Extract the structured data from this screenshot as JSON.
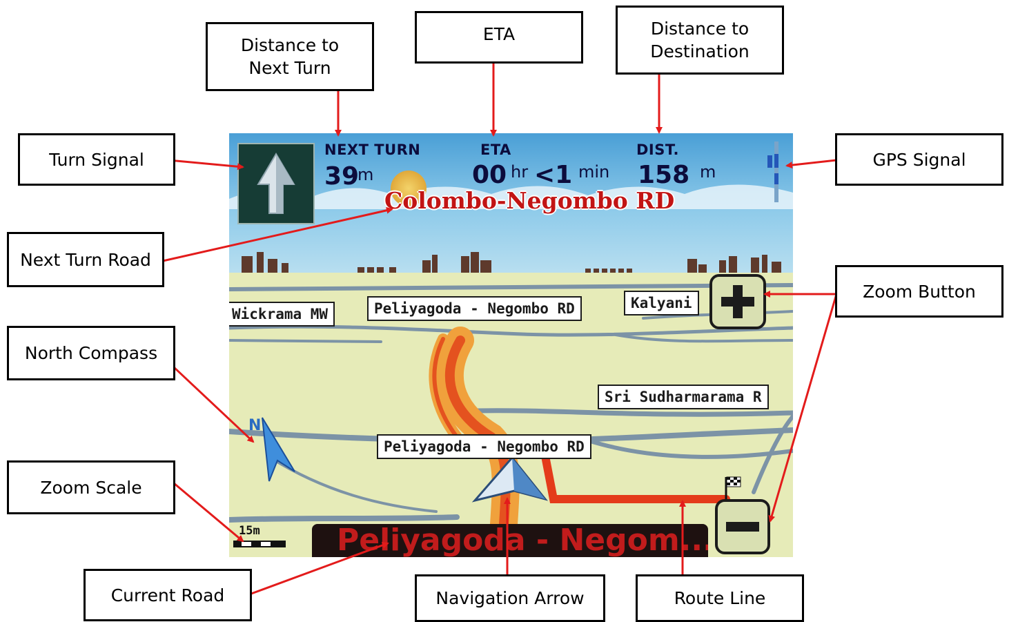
{
  "callouts": {
    "distance_next_turn": "Distance to\nNext Turn",
    "eta": "ETA",
    "distance_destination": "Distance to\nDestination",
    "turn_signal": "Turn Signal",
    "gps_signal": "GPS Signal",
    "next_turn_road": "Next Turn Road",
    "zoom_button": "Zoom Button",
    "north_compass": "North Compass",
    "zoom_scale": "Zoom Scale",
    "current_road": "Current Road",
    "navigation_arrow": "Navigation Arrow",
    "route_line": "Route Line"
  },
  "header": {
    "next_turn_label": "NEXT TURN",
    "next_turn_value": "39",
    "next_turn_unit": "m",
    "eta_label": "ETA",
    "eta_hours": "00",
    "eta_hours_unit": "hr",
    "eta_minutes": "<1",
    "eta_minutes_unit": "min",
    "dist_label": "DIST.",
    "dist_value": "158",
    "dist_unit": "m"
  },
  "next_turn_road": "Colombo-Negombo RD",
  "map_labels": {
    "wickrama": "Wickrama MW",
    "peliyagoda_top": "Peliyagoda - Negombo RD",
    "kalyani": "Kalyani",
    "sri_sudharmarama": "Sri Sudharmarama R",
    "peliyagoda_bottom": "Peliyagoda - Negombo RD"
  },
  "zoom_scale": "15m",
  "current_road": "Peliyagoda - Negom...",
  "icons": {
    "turn": "straight-arrow-icon",
    "gps": "gps-bars-icon",
    "compass": "north-compass-icon",
    "nav": "navigation-arrow-icon",
    "flag": "checkered-flag-icon",
    "zoom_in": "plus-icon",
    "zoom_out": "minus-icon"
  },
  "colors": {
    "route": "#e43b1a",
    "road_title": "#c21414",
    "sky": "#6bb8e2",
    "ground": "#e6ebb8",
    "annotation": "#e31b1b"
  }
}
